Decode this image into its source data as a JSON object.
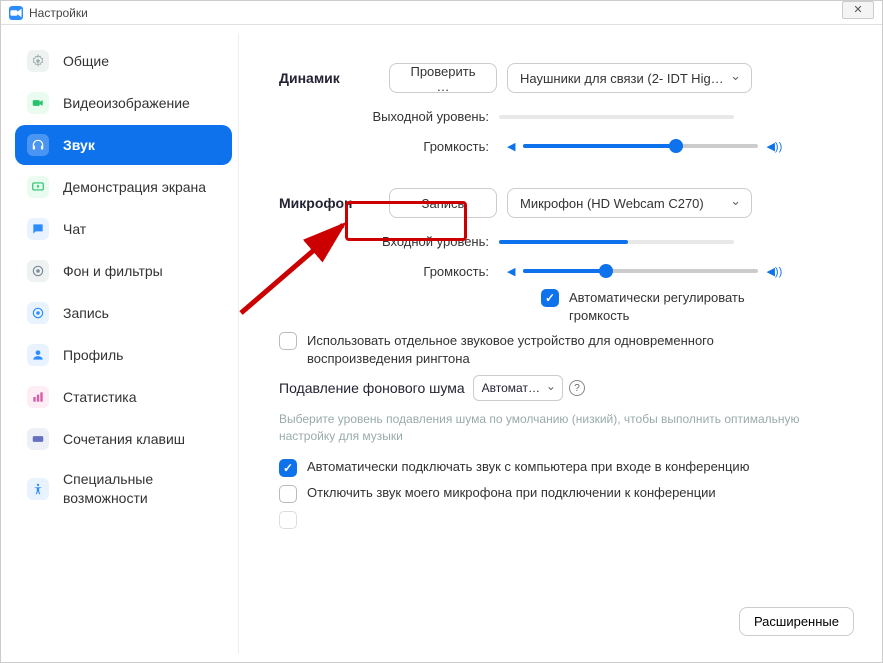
{
  "window": {
    "title": "Настройки",
    "close": "✕"
  },
  "sidebar": {
    "items": [
      {
        "label": "Общие"
      },
      {
        "label": "Видеоизображение"
      },
      {
        "label": "Звук"
      },
      {
        "label": "Демонстрация экрана"
      },
      {
        "label": "Чат"
      },
      {
        "label": "Фон и фильтры"
      },
      {
        "label": "Запись"
      },
      {
        "label": "Профиль"
      },
      {
        "label": "Статистика"
      },
      {
        "label": "Сочетания клавиш"
      },
      {
        "label": "Специальные возможности"
      }
    ]
  },
  "speaker": {
    "section": "Динамик",
    "test_btn": "Проверить …",
    "device": "Наушники для связи (2- IDT Hig…",
    "out_level_label": "Выходной уровень:",
    "out_level_pct": 0,
    "vol_label": "Громкость:",
    "vol_pct": 65
  },
  "mic": {
    "section": "Микрофон",
    "record_btn": "Запись",
    "device": "Микрофон (HD Webcam C270)",
    "in_level_label": "Входной уровень:",
    "in_level_pct": 55,
    "vol_label": "Громкость:",
    "vol_pct": 35,
    "auto_gain": "Автоматически регулировать громкость"
  },
  "options": {
    "ringtone_sep": "Использовать отдельное звуковое устройство для одновременного воспроизведения рингтона",
    "noise_label": "Подавление фонового шума",
    "noise_select": "Автомат…",
    "noise_note": "Выберите уровень подавления шума по умолчанию (низкий), чтобы выполнить оптимальную настройку для музыки",
    "auto_join_audio": "Автоматически подключать звук с компьютера при входе в конференцию",
    "mute_on_join": "Отключить звук моего микрофона при подключении к конференции"
  },
  "advanced": "Расширенные",
  "colors": {
    "accent": "#0E72ED",
    "highlight": "#c00"
  }
}
